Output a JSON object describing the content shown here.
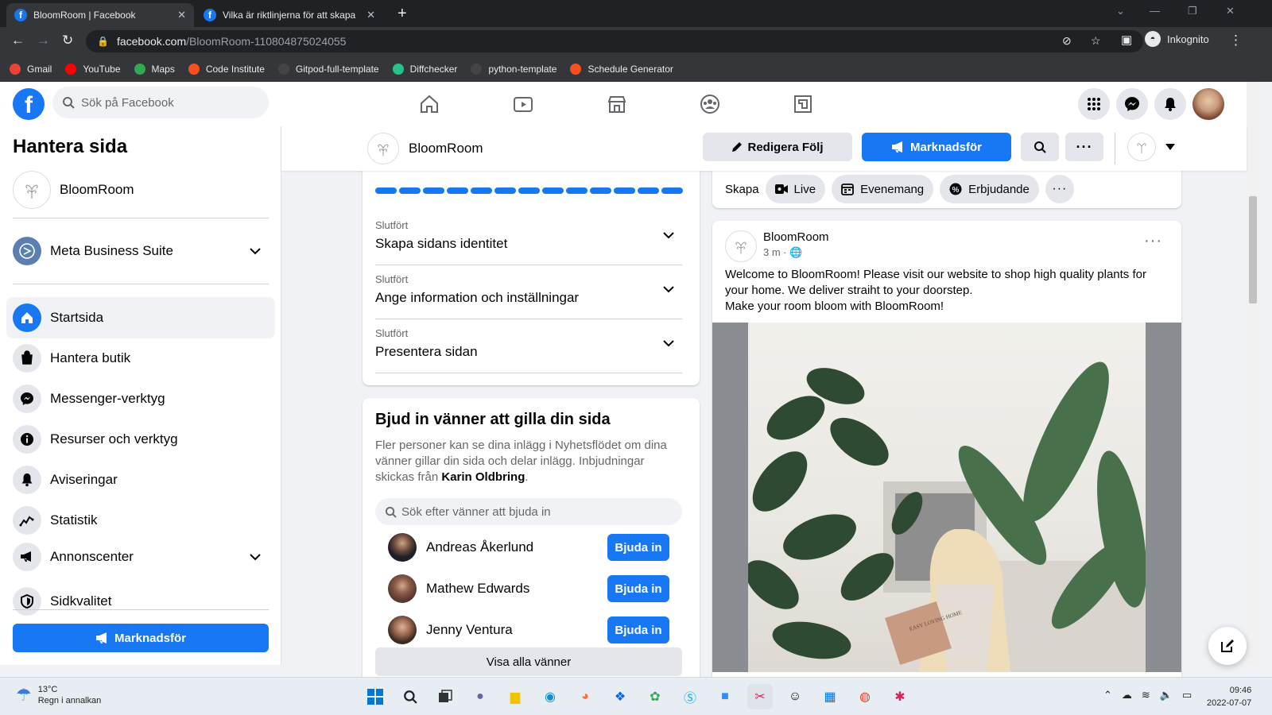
{
  "browser": {
    "tabs": [
      {
        "title": "BloomRoom | Facebook",
        "active": true
      },
      {
        "title": "Vilka är riktlinjerna för att skapa",
        "active": false
      }
    ],
    "url_domain": "facebook.com",
    "url_path": "/BloomRoom-110804875024055",
    "profile_label": "Inkognito",
    "bookmarks": [
      {
        "label": "Gmail",
        "icon": "gmail-icon",
        "color": "#ea4335"
      },
      {
        "label": "YouTube",
        "icon": "youtube-icon",
        "color": "#ff0000"
      },
      {
        "label": "Maps",
        "icon": "maps-icon",
        "color": "#34a853"
      },
      {
        "label": "Code Institute",
        "icon": "code-institute-icon",
        "color": "#f4511e"
      },
      {
        "label": "Gitpod-full-template",
        "icon": "github-icon",
        "color": "#444444"
      },
      {
        "label": "Diffchecker",
        "icon": "diffchecker-icon",
        "color": "#27c28a"
      },
      {
        "label": "python-template",
        "icon": "github-icon",
        "color": "#444444"
      },
      {
        "label": "Schedule Generator",
        "icon": "schedule-icon",
        "color": "#f4511e"
      }
    ]
  },
  "fb": {
    "search_placeholder": "Sök på Facebook",
    "brand_color": "#1877f2"
  },
  "left_nav": {
    "title": "Hantera sida",
    "page_name": "BloomRoom",
    "business_suite": "Meta Business Suite",
    "items": [
      {
        "label": "Startsida",
        "icon": "home-icon",
        "active": true
      },
      {
        "label": "Hantera butik",
        "icon": "shopping-bag-icon"
      },
      {
        "label": "Messenger-verktyg",
        "icon": "messenger-icon"
      },
      {
        "label": "Resurser och verktyg",
        "icon": "info-icon"
      },
      {
        "label": "Aviseringar",
        "icon": "bell-icon"
      },
      {
        "label": "Statistik",
        "icon": "chart-icon"
      },
      {
        "label": "Annonscenter",
        "icon": "megaphone-icon"
      },
      {
        "label": "Sidkvalitet",
        "icon": "shield-icon"
      }
    ],
    "promote_button": "Marknadsför"
  },
  "page_bar": {
    "page_name": "BloomRoom",
    "edit_follow": "Redigera Följ",
    "promote": "Marknadsför"
  },
  "setup": {
    "progress_segments": 13,
    "steps": [
      {
        "status": "Slutfört",
        "title": "Skapa sidans identitet"
      },
      {
        "status": "Slutfört",
        "title": "Ange information och inställningar"
      },
      {
        "status": "Slutfört",
        "title": "Presentera sidan"
      }
    ]
  },
  "invite": {
    "title": "Bjud in vänner att gilla din sida",
    "description": "Fler personer kan se dina inlägg i Nyhetsflödet om dina vänner gillar din sida och delar inlägg. Inbjudningar skickas från ",
    "inviter": "Karin Oldbring",
    "search_placeholder": "Sök efter vänner att bjuda in",
    "friends": [
      {
        "name": "Andreas Åkerlund",
        "button": "Bjuda in"
      },
      {
        "name": "Mathew Edwards",
        "button": "Bjuda in"
      },
      {
        "name": "Jenny Ventura",
        "button": "Bjuda in"
      }
    ],
    "show_all": "Visa alla vänner"
  },
  "create": {
    "label": "Skapa",
    "live": "Live",
    "event": "Evenemang",
    "offer": "Erbjudande"
  },
  "post": {
    "author": "BloomRoom",
    "time": "3 m ·",
    "text_line1": "Welcome to BloomRoom! Please visit our website to shop high quality plants for your home. We deliver straiht to your doorstep.",
    "text_line2": "Make your room bloom with BloomRoom!",
    "book_text": "EASY LOVING HOME"
  },
  "taskbar": {
    "temp": "13°C",
    "weather": "Regn i annalkan",
    "time": "09:46",
    "date": "2022-07-07"
  }
}
